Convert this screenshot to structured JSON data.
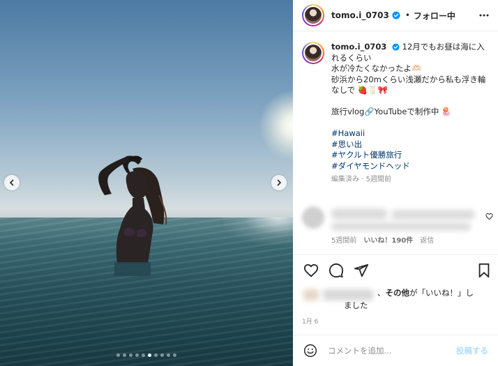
{
  "post": {
    "slides_total": 10,
    "active_slide": 6
  },
  "header": {
    "username": "tomo.i_0703",
    "separator": "•",
    "follow_label": "フォロー中",
    "more_icon": "more-horizontal-icon"
  },
  "caption": {
    "username": "tomo.i_0703",
    "lines": [
      "12月でもお昼は海に入れるくらい",
      "水が冷たくなかったよ🫶🏻",
      "砂浜から20mくらい浅瀬だから私も浮き輪なしで 🍓🥛🎀"
    ],
    "line2": "旅行vlog🔗YouTubeで制作中 🪼",
    "hashtags": [
      "#Hawaii",
      "#思い出",
      "#ヤクルト優勝旅行",
      "#ダイヤモンドヘッド"
    ],
    "meta": "編集済み · 5週間前"
  },
  "comment": {
    "time": "5週間前",
    "likes": "いいね！190件",
    "reply": "返信"
  },
  "actions": {
    "like_icon": "heart-icon",
    "comment_icon": "comment-bubble-icon",
    "share_icon": "send-icon",
    "save_icon": "bookmark-icon"
  },
  "likes": {
    "prefix": "、",
    "others": "その他",
    "suffix_a": "が「いいね！」し",
    "suffix_b": "ました"
  },
  "date": "1月 6",
  "add_comment": {
    "placeholder": "コメントを追加...",
    "post_label": "投稿する"
  },
  "colors": {
    "link": "#00376b",
    "verified": "#0095f6",
    "post_button_disabled": "#b2dffc"
  }
}
